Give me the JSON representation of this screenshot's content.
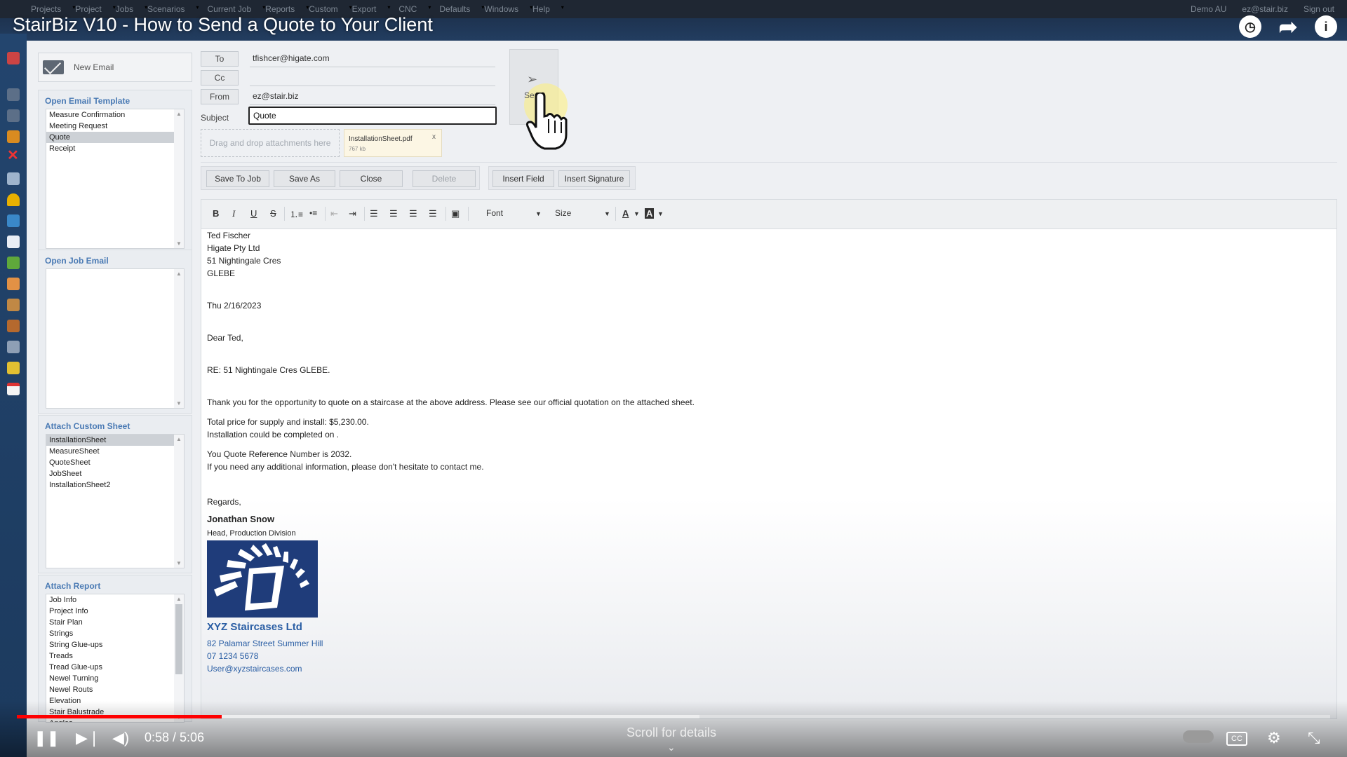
{
  "menubar": {
    "items": [
      "Projects",
      "Project",
      "Jobs",
      "Scenarios",
      "Current Job",
      "Reports",
      "Custom",
      "Export",
      "CNC",
      "Defaults",
      "Windows",
      "Help"
    ],
    "right": [
      "Demo AU",
      "ez@stair.biz",
      "Sign out"
    ]
  },
  "video": {
    "title": "StairBiz V10 - How to Send a Quote to Your Client",
    "time": "0:58 / 5:06",
    "scroll_hint": "Scroll for details",
    "progress_fraction": 0.156,
    "buffered_fraction": 0.52
  },
  "new_email": {
    "label": "New Email"
  },
  "open_email_template": {
    "title": "Open Email Template",
    "items": [
      "Measure Confirmation",
      "Meeting Request",
      "Quote",
      "Receipt"
    ],
    "selected": 2
  },
  "open_job_email": {
    "title": "Open Job Email"
  },
  "attach_custom_sheet": {
    "title": "Attach Custom Sheet",
    "items": [
      "InstallationSheet",
      "MeasureSheet",
      "QuoteSheet",
      "JobSheet",
      "InstallationSheet2"
    ],
    "selected": 0
  },
  "attach_report": {
    "title": "Attach Report",
    "items": [
      "Job Info",
      "Project Info",
      "Stair Plan",
      "Strings",
      "String Glue-ups",
      "Treads",
      "Tread Glue-ups",
      "Newel Turning",
      "Newel Routs",
      "Elevation",
      "Stair Balustrade",
      "Angles"
    ]
  },
  "email": {
    "to_label": "To",
    "cc_label": "Cc",
    "from_label": "From",
    "subject_label": "Subject",
    "to": "tfishcer@higate.com",
    "cc": "",
    "from": "ez@stair.biz",
    "subject": "Quote",
    "send_label": "Send",
    "dropzone": "Drag and drop attachments here",
    "attachment": {
      "name": "InstallationSheet.pdf",
      "size": "767 kb",
      "remove": "x"
    }
  },
  "actions": {
    "save_to_job": "Save To Job",
    "save_as": "Save As",
    "close": "Close",
    "delete": "Delete",
    "insert_field": "Insert Field",
    "insert_signature": "Insert Signature"
  },
  "editor_toolbar": {
    "bold": "B",
    "italic": "I",
    "underline": "U",
    "strike": "S",
    "font": "Font",
    "size": "Size",
    "text_color": "A",
    "bg_color": "A"
  },
  "body": {
    "address": [
      "Ted Fischer",
      "Higate Pty Ltd",
      "51 Nightingale Cres",
      "GLEBE"
    ],
    "date": "Thu 2/16/2023",
    "greeting": "Dear Ted,",
    "re": "RE: 51 Nightingale Cres GLEBE.",
    "p1": "Thank you for the opportunity to quote on a staircase at the above address. Please see our official quotation on the attached sheet.",
    "p2a": "Total price for supply and install: $5,230.00.",
    "p2b": "Installation could be completed on .",
    "p3a": "You Quote Reference Number is 2032.",
    "p3b": "If you need any additional information, please don't hesitate to contact me.",
    "regards": "Regards,",
    "sig_name": "Jonathan Snow",
    "sig_title": "Head, Production Division",
    "company": "XYZ Staircases Ltd",
    "street": "82 Palamar Street Summer Hill",
    "phone": "07 1234 5678",
    "email": "User@xyzstaircases.com"
  },
  "colors": {
    "accent": "#4a7ab4",
    "link": "#2a5ea4",
    "progress": "#ff0000",
    "highlight": "#fff078"
  }
}
